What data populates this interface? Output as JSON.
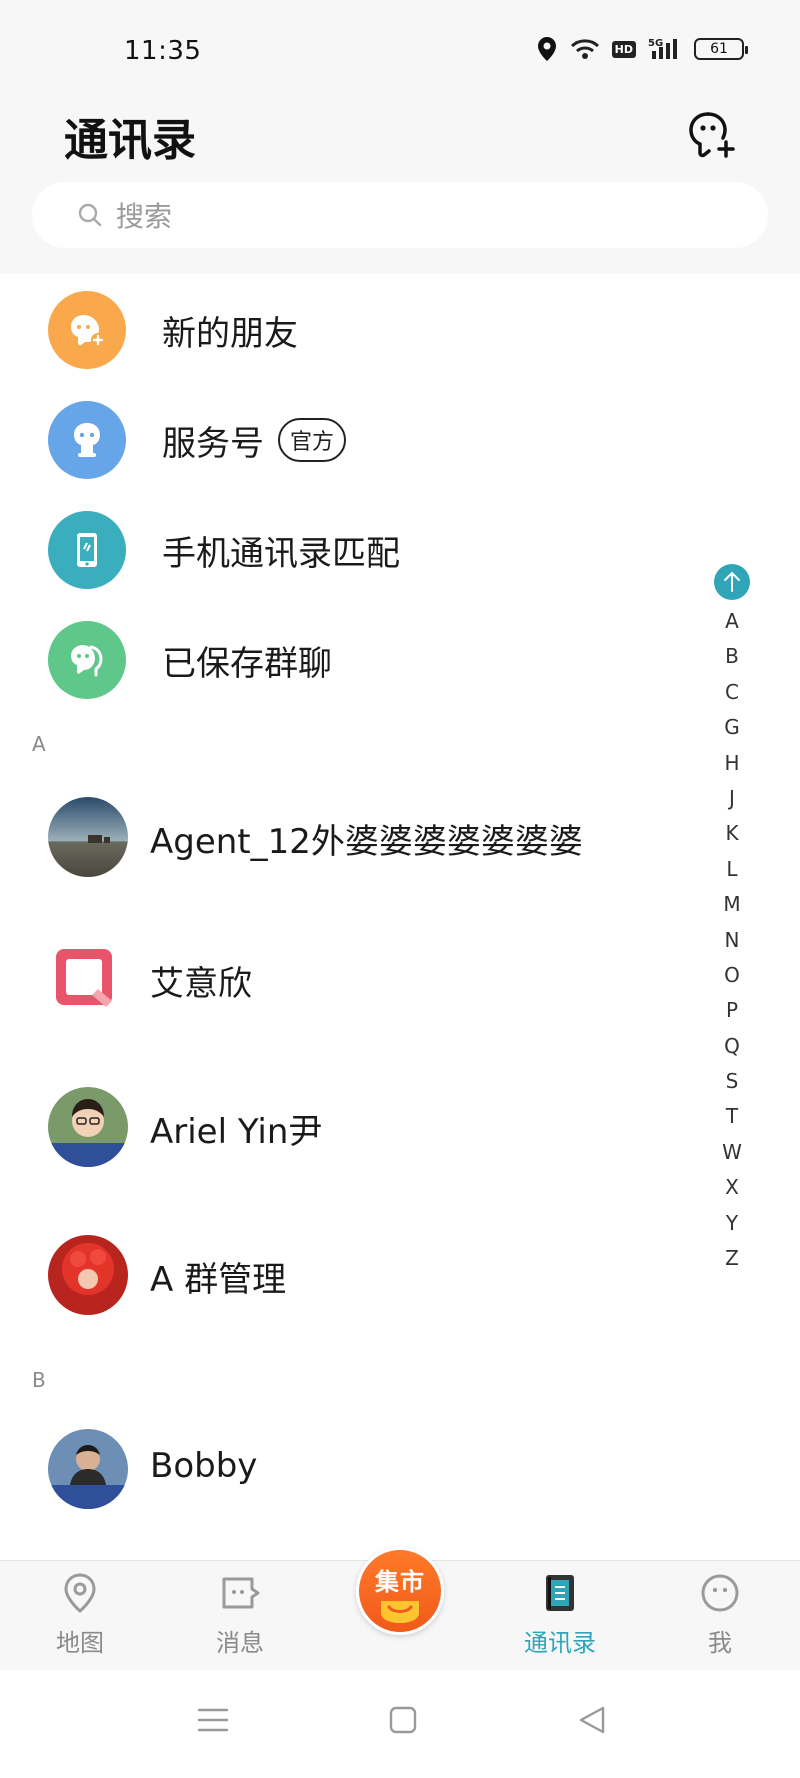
{
  "status_bar": {
    "time": "11:35",
    "network": "5G",
    "hd": "HD",
    "battery": "61"
  },
  "header": {
    "title": "通讯录",
    "search_placeholder": "搜索"
  },
  "functions": [
    {
      "label": "新的朋友",
      "icon": "person-plus-icon",
      "color": "#f9a94b"
    },
    {
      "label": "服务号",
      "badge": "官方",
      "icon": "service-icon",
      "color": "#66a6e8"
    },
    {
      "label": "手机通讯录匹配",
      "icon": "phone-icon",
      "color": "#3aaebd"
    },
    {
      "label": "已保存群聊",
      "icon": "group-icon",
      "color": "#5fc78a"
    }
  ],
  "sections": [
    {
      "letter": "A",
      "contacts": [
        "Agent_12外婆婆婆婆婆婆婆",
        "艾意欣",
        "Ariel Yin尹",
        "A  群管理"
      ]
    },
    {
      "letter": "B",
      "contacts": [
        "Bobby"
      ]
    }
  ],
  "alphabet_index": [
    "A",
    "B",
    "C",
    "G",
    "H",
    "J",
    "K",
    "L",
    "M",
    "N",
    "O",
    "P",
    "Q",
    "S",
    "T",
    "W",
    "X",
    "Y",
    "Z"
  ],
  "bottom_nav": {
    "map": "地图",
    "messages": "消息",
    "market": "集市",
    "contacts": "通讯录",
    "me": "我"
  },
  "colors": {
    "accent": "#30a5b8",
    "market": "#f26522"
  }
}
